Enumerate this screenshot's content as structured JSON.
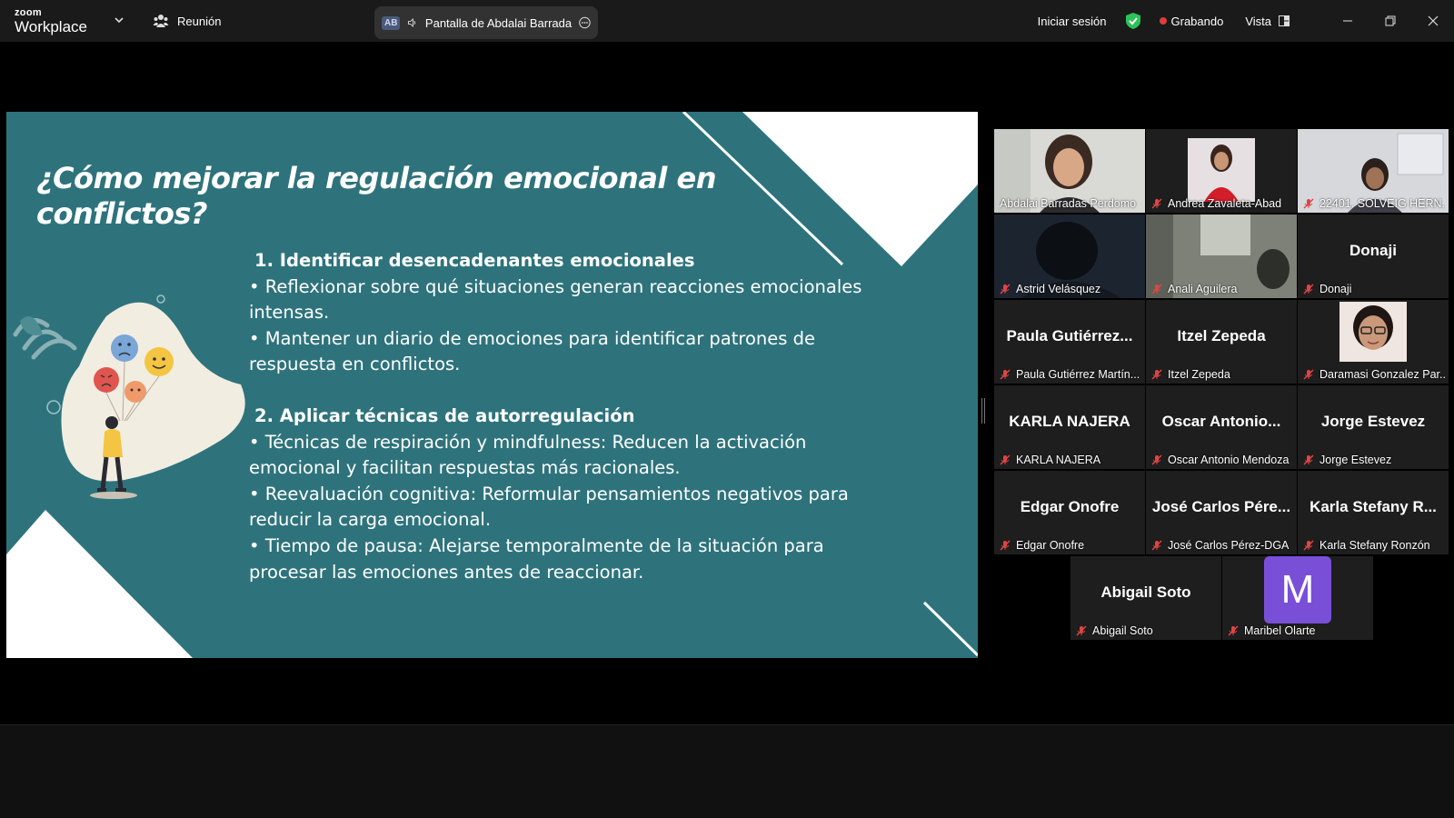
{
  "app": {
    "logo_small": "zoom",
    "logo_large": "Workplace",
    "meeting_label": "Reunión"
  },
  "share": {
    "initials": "AB",
    "title": "Pantalla de Abdalai Barrada"
  },
  "topbar": {
    "signin": "Iniciar sesión",
    "recording": "Grabando",
    "view": "Vista"
  },
  "slide": {
    "title": "¿Cómo mejorar la regulación emocional en conflictos?",
    "section1": {
      "heading": "1. Identificar desencadenantes emocionales",
      "bullets": [
        "Reflexionar sobre qué situaciones generan reacciones emocionales intensas.",
        "Mantener un diario de emociones para identificar patrones de respuesta en conflictos."
      ]
    },
    "section2": {
      "heading": "2. Aplicar técnicas de autorregulación",
      "bullets": [
        "Técnicas de respiración y mindfulness: Reducen la activación emocional y facilitan respuestas más racionales.",
        "Reevaluación cognitiva: Reformular pensamientos negativos para reducir la carga emocional.",
        "Tiempo de pausa: Alejarse temporalmente de la situación para procesar las emociones antes de reaccionar."
      ]
    }
  },
  "participants": [
    {
      "label": "Abdalai Barradas Perdomo",
      "video": true,
      "active": true
    },
    {
      "label": "Andrea Zavaleta-Abad",
      "video": true
    },
    {
      "label": "22401. SOLVEIG HERN...",
      "video": true
    },
    {
      "label": "Astrid Velásquez",
      "video": true
    },
    {
      "label": "Anali Aguilera",
      "video": true
    },
    {
      "label": "Donaji",
      "center": "Donaji"
    },
    {
      "label": "Paula Gutiérrez Martín...",
      "center": "Paula Gutiérrez..."
    },
    {
      "label": "Itzel Zepeda",
      "center": "Itzel Zepeda"
    },
    {
      "label": "Daramasi Gonzalez Par...",
      "video": true
    },
    {
      "label": "KARLA NAJERA",
      "center": "KARLA NAJERA"
    },
    {
      "label": "Oscar Antonio Mendoza",
      "center": "Oscar Antonio..."
    },
    {
      "label": "Jorge Estevez",
      "center": "Jorge Estevez"
    },
    {
      "label": "Edgar Onofre",
      "center": "Edgar Onofre"
    },
    {
      "label": "José Carlos Pérez-DGA",
      "center": "José Carlos Pére..."
    },
    {
      "label": "Karla Stefany Ronzón",
      "center": "Karla Stefany R..."
    },
    {
      "label": "Abigail Soto",
      "center": "Abigail Soto"
    },
    {
      "label": "Maribel Olarte",
      "avatar": "M"
    }
  ],
  "colors": {
    "slide_bg": "#2e737c",
    "active_speaker": "#2ed35c",
    "recording": "#e03c3c",
    "avatar": "#7a4fd8"
  }
}
